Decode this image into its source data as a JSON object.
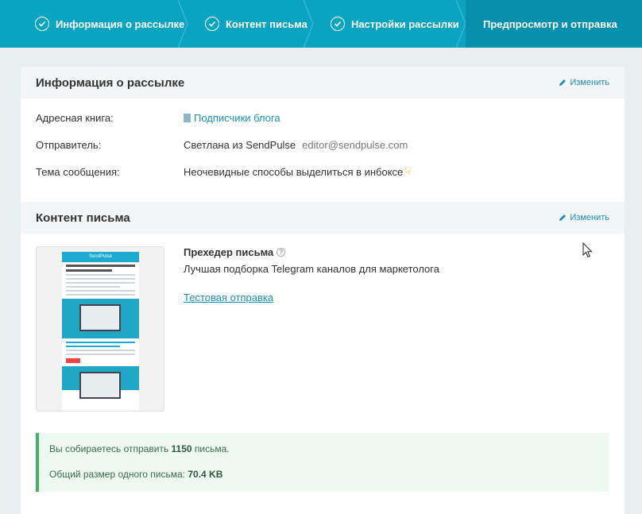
{
  "stepper": {
    "steps": [
      {
        "label": "Информация о рассылке",
        "done": true
      },
      {
        "label": "Контент письма",
        "done": true
      },
      {
        "label": "Настройки рассылки",
        "done": true
      },
      {
        "label": "Предпросмотр и отправка",
        "done": false,
        "active": true
      }
    ]
  },
  "info_section": {
    "title": "Информация о рассылке",
    "edit_label": "Изменить",
    "rows": {
      "address_book_label": "Адресная книга:",
      "address_book_value": "Подписчики блога",
      "sender_label": "Отправитель:",
      "sender_name": "Светлана из SendPulse",
      "sender_email": "editor@sendpulse.com",
      "subject_label": "Тема сообщения:",
      "subject_value": "Неочевидные способы выделиться в инбоксе"
    }
  },
  "content_section": {
    "title": "Контент письма",
    "edit_label": "Изменить",
    "preheader_title": "Прехедер письма",
    "preheader_text": "Лучшая подборка Telegram каналов для маркетолога",
    "test_send_label": "Тестовая отправка",
    "thumbnail_brand": "SendPulse"
  },
  "summary": {
    "send_prefix": "Вы собираетесь отправить ",
    "send_count": "1150",
    "send_suffix": " письма.",
    "size_prefix": "Общий размер одного письма: ",
    "size_value": "70.4 KB"
  },
  "colors": {
    "accent": "#0aa3c2",
    "link": "#1a8fb3",
    "success_border": "#41b36b"
  }
}
